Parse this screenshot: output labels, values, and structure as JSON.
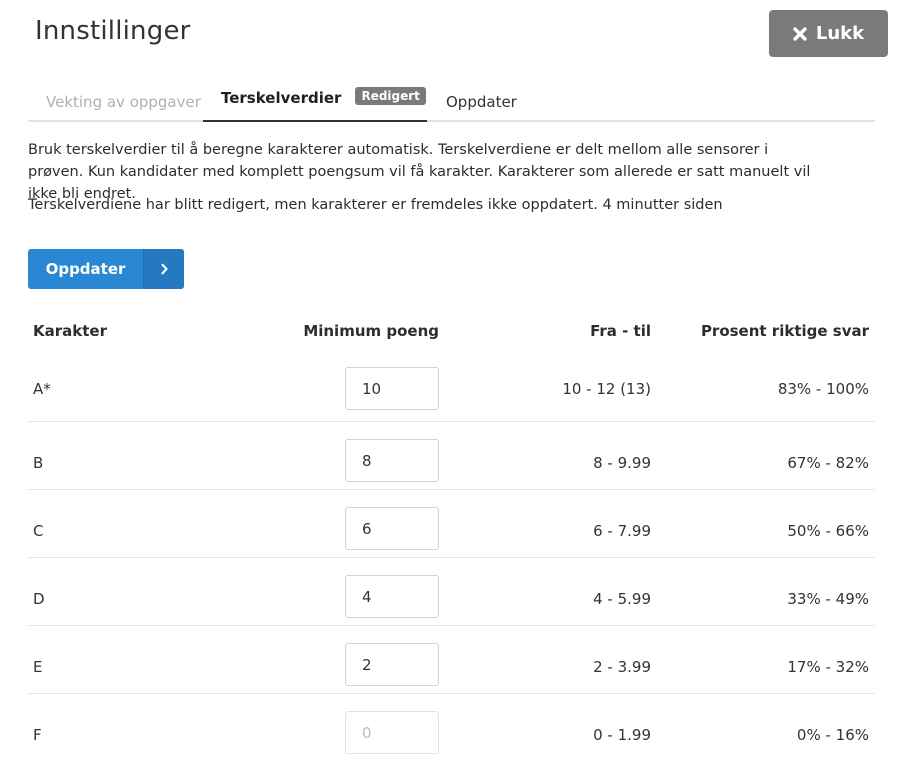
{
  "title": "Innstillinger",
  "close_button": {
    "label": "Lukk",
    "icon": "close-icon"
  },
  "tabs": [
    {
      "id": "weight",
      "label": "Vekting av oppgaver",
      "state": "disabled"
    },
    {
      "id": "threshold",
      "label": "Terskelverdier",
      "state": "active",
      "badge": "Redigert"
    },
    {
      "id": "update",
      "label": "Oppdater",
      "state": "normal"
    }
  ],
  "description": "Bruk terskelverdier til å beregne karakterer automatisk. Terskelverdiene er delt mellom alle sensorer i prøven. Kun kandidater med komplett poengsum vil få karakter. Karakterer som allerede er satt manuelt vil ikke bli endret.",
  "status": "Terskelverdiene har blitt redigert, men karakterer er fremdeles ikke oppdatert. 4 minutter siden",
  "update_button": {
    "label": "Oppdater",
    "icon": "chevron-right-icon"
  },
  "table": {
    "headers": {
      "grade": "Karakter",
      "min": "Minimum poeng",
      "range": "Fra - til",
      "percent": "Prosent riktige svar"
    },
    "rows": [
      {
        "grade": "A*",
        "min": "10",
        "range": "10 - 12 (13)",
        "percent": "83% - 100%",
        "editable": true
      },
      {
        "grade": "B",
        "min": "8",
        "range": "8 - 9.99",
        "percent": "67% - 82%",
        "editable": true
      },
      {
        "grade": "C",
        "min": "6",
        "range": "6 - 7.99",
        "percent": "50% - 66%",
        "editable": true
      },
      {
        "grade": "D",
        "min": "4",
        "range": "4 - 5.99",
        "percent": "33% - 49%",
        "editable": true
      },
      {
        "grade": "E",
        "min": "2",
        "range": "2 - 3.99",
        "percent": "17% - 32%",
        "editable": true
      },
      {
        "grade": "F",
        "min": "0",
        "range": "0 - 1.99",
        "percent": "0% - 16%",
        "editable": false
      }
    ]
  },
  "colors": {
    "primary": "#2a87d3",
    "close_bg": "#7a7a7a",
    "badge_bg": "#7a7a7a"
  }
}
